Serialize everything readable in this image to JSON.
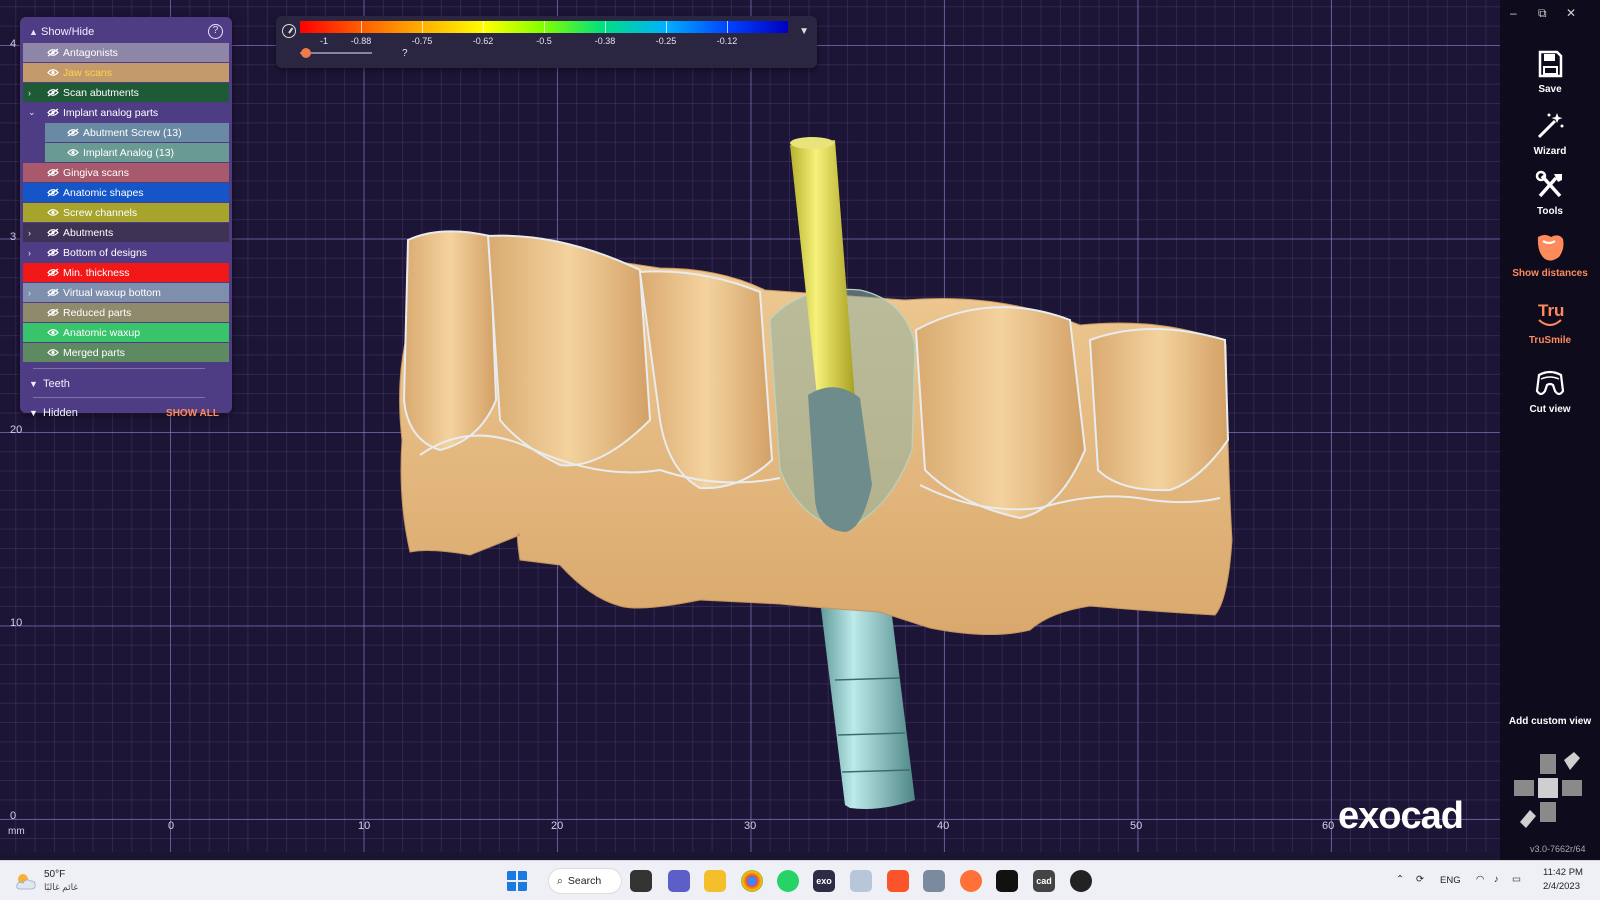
{
  "viewport": {
    "axis_x_ticks": [
      "0",
      "10",
      "20",
      "30",
      "40",
      "50",
      "60"
    ],
    "axis_y_ticks": [
      "0",
      "10",
      "20",
      "3",
      "4"
    ],
    "axis_unit": "mm"
  },
  "colorbar": {
    "labels": [
      "-1",
      "-0.88",
      "-0.75",
      "-0.62",
      "-0.5",
      "-0.38",
      "-0.25",
      "-0.12"
    ],
    "help_label": "?"
  },
  "panel": {
    "title": "Show/Hide",
    "help": "?",
    "items": [
      {
        "label": "Antagonists",
        "color": "#8e86a7",
        "visible": false,
        "indent": 0,
        "expander": ""
      },
      {
        "label": "Jaw scans",
        "color": "#c39a6b",
        "visible": true,
        "indent": 0,
        "expander": "",
        "text_color": "#ffd54a"
      },
      {
        "label": "Scan abutments",
        "color": "#1e5a36",
        "visible": false,
        "indent": 0,
        "expander": "›"
      },
      {
        "label": "Implant analog parts",
        "color": "#4e3d84",
        "visible": false,
        "indent": 0,
        "expander": "⌄"
      },
      {
        "label": "Abutment Screw (13)",
        "color": "#6a8aa3",
        "visible": false,
        "indent": 1,
        "expander": ""
      },
      {
        "label": "Implant Analog (13)",
        "color": "#6a9a94",
        "visible": true,
        "indent": 1,
        "expander": ""
      },
      {
        "label": "Gingiva scans",
        "color": "#a85a6c",
        "visible": false,
        "indent": 0,
        "expander": ""
      },
      {
        "label": "Anatomic shapes",
        "color": "#1456c8",
        "visible": false,
        "indent": 0,
        "expander": ""
      },
      {
        "label": "Screw channels",
        "color": "#a7a42e",
        "visible": true,
        "indent": 0,
        "expander": ""
      },
      {
        "label": "Abutments",
        "color": "#3e3354",
        "visible": false,
        "indent": 0,
        "expander": "›"
      },
      {
        "label": "Bottom of designs",
        "color": "#4e3d84",
        "visible": false,
        "indent": 0,
        "expander": "›"
      },
      {
        "label": "Min. thickness",
        "color": "#f21818",
        "visible": false,
        "indent": 0,
        "expander": ""
      },
      {
        "label": "Virtual waxup bottom",
        "color": "#7e8fae",
        "visible": false,
        "indent": 0,
        "expander": "›"
      },
      {
        "label": "Reduced parts",
        "color": "#8f8a6c",
        "visible": false,
        "indent": 0,
        "expander": ""
      },
      {
        "label": "Anatomic waxup",
        "color": "#37c46a",
        "visible": true,
        "indent": 0,
        "expander": ""
      },
      {
        "label": "Merged parts",
        "color": "#5e8a62",
        "visible": true,
        "indent": 0,
        "expander": ""
      }
    ],
    "teeth_label": "Teeth",
    "hidden_label": "Hidden",
    "show_all": "SHOW ALL"
  },
  "toolbar": {
    "tools": [
      {
        "label": "Save",
        "icon": "save-icon"
      },
      {
        "label": "Wizard",
        "icon": "wizard-icon"
      },
      {
        "label": "Tools",
        "icon": "tools-icon"
      },
      {
        "label": "Show distances",
        "icon": "show-distances-icon",
        "accent": true
      },
      {
        "label": "TruSmile",
        "icon": "trusmile-icon",
        "accent": true
      },
      {
        "label": "Cut view",
        "icon": "cut-view-icon"
      }
    ],
    "add_custom_view": "Add custom view",
    "version": "v3.0-7662r/64",
    "logo": "exocad",
    "window_controls": [
      "–",
      "⧉",
      "✕"
    ]
  },
  "taskbar": {
    "weather_temp": "50°F",
    "weather_text": "غائم غالبًا",
    "search_label": "Search",
    "language": "ENG",
    "time": "11:42 PM",
    "date": "2/4/2023",
    "app_icon_label": "exo",
    "cad_icon_label": "cad"
  }
}
